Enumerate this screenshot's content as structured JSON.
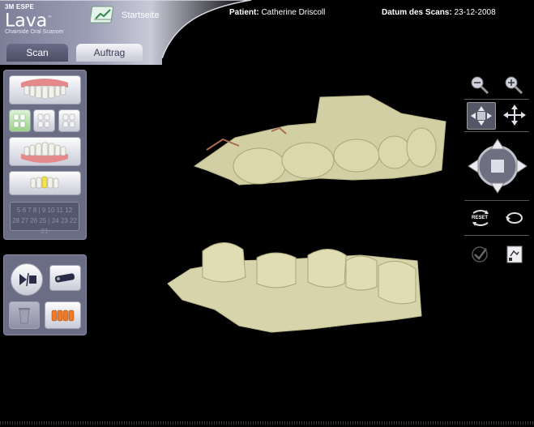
{
  "brand": {
    "company": "3M ESPE",
    "product": "Lava",
    "tm": "™",
    "subtitle": "Chairside Oral Scanner"
  },
  "header": {
    "home_label": "Startseite",
    "patient_label": "Patient:",
    "patient_name": "Catherine Driscoll",
    "scan_date_label": "Datum des Scans:",
    "scan_date": "23-12-2008"
  },
  "tabs": [
    {
      "label": "Scan",
      "active": true
    },
    {
      "label": "Auftrag",
      "active": false
    }
  ],
  "tooth_numbers": {
    "upper": "5 6 7 8 | 9 10 11 12",
    "lower": "28 27 26 25 | 24 23 22 21"
  },
  "right_tools": {
    "reset_label": "RESET"
  },
  "colors": {
    "accent": "#6b6d84",
    "model": "#d7d4ac",
    "background": "#000000"
  }
}
